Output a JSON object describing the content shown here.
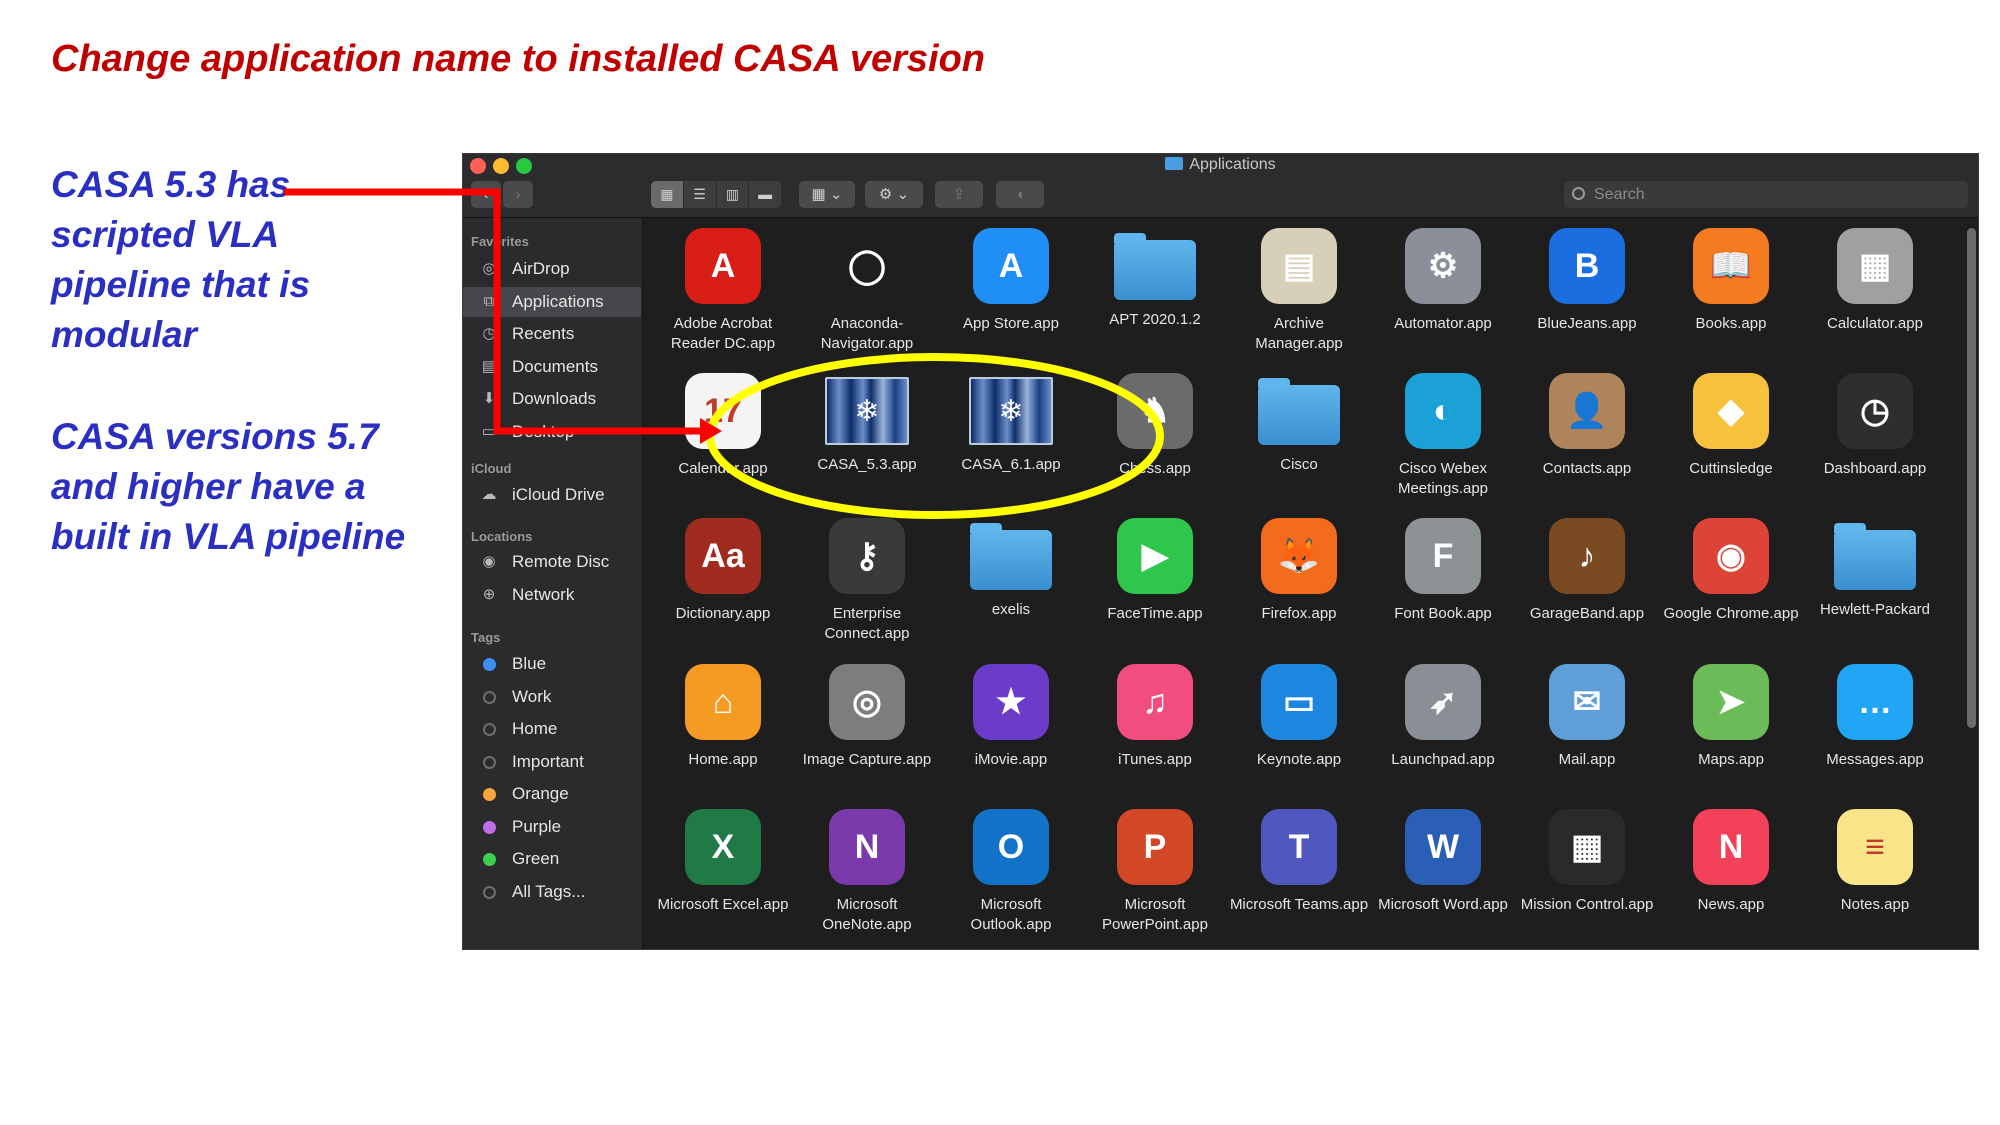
{
  "slide": {
    "title": "Change application name to installed CASA version",
    "note1_lines": [
      "CASA 5.3 has",
      "scripted VLA",
      "pipeline that is",
      "modular"
    ],
    "note2_lines": [
      "CASA versions 5.7",
      "and higher have a",
      "built in VLA pipeline"
    ]
  },
  "window": {
    "title": "Applications",
    "search_placeholder": "Search"
  },
  "sidebar": {
    "favorites_label": "Favorites",
    "favorites": [
      {
        "label": "AirDrop",
        "icon": "airdrop-icon"
      },
      {
        "label": "Applications",
        "icon": "applications-icon",
        "selected": true
      },
      {
        "label": "Recents",
        "icon": "recents-icon"
      },
      {
        "label": "Documents",
        "icon": "documents-icon"
      },
      {
        "label": "Downloads",
        "icon": "downloads-icon"
      },
      {
        "label": "Desktop",
        "icon": "desktop-icon"
      }
    ],
    "icloud_label": "iCloud",
    "icloud": [
      {
        "label": "iCloud Drive",
        "icon": "cloud-icon"
      }
    ],
    "locations_label": "Locations",
    "locations": [
      {
        "label": "Remote Disc",
        "icon": "disc-icon"
      },
      {
        "label": "Network",
        "icon": "globe-icon"
      }
    ],
    "tags_label": "Tags",
    "tags": [
      {
        "label": "Blue",
        "color": "#3b8ff5"
      },
      {
        "label": "Work",
        "color": "#2b2a2c"
      },
      {
        "label": "Home",
        "color": "#2b2a2c"
      },
      {
        "label": "Important",
        "color": "#2b2a2c"
      },
      {
        "label": "Orange",
        "color": "#f7a43a"
      },
      {
        "label": "Purple",
        "color": "#bf6ee6"
      },
      {
        "label": "Green",
        "color": "#3fcf4f"
      },
      {
        "label": "All Tags...",
        "color": "#2b2a2c"
      }
    ]
  },
  "apps": [
    {
      "label": "Adobe Acrobat Reader DC.app",
      "icon": "acrobat-icon",
      "bg": "#d91e18",
      "glyph": "A"
    },
    {
      "label": "Anaconda-Navigator.app",
      "icon": "anaconda-icon",
      "bg": "#1e1e1e",
      "glyph": "◯"
    },
    {
      "label": "App Store.app",
      "icon": "app-store-icon",
      "bg": "#1f8ff5",
      "glyph": "A"
    },
    {
      "label": "APT 2020.1.2",
      "icon": "folder-icon",
      "folder": true
    },
    {
      "label": "Archive Manager.app",
      "icon": "archive-icon",
      "bg": "#d8cfb8",
      "glyph": "▤"
    },
    {
      "label": "Automator.app",
      "icon": "automator-icon",
      "bg": "#8a8f99",
      "glyph": "⚙"
    },
    {
      "label": "BlueJeans.app",
      "icon": "bluejeans-icon",
      "bg": "#1b6ee0",
      "glyph": "B"
    },
    {
      "label": "Books.app",
      "icon": "books-icon",
      "bg": "#f47b20",
      "glyph": "📖"
    },
    {
      "label": "Calculator.app",
      "icon": "calculator-icon",
      "bg": "#a0a0a0",
      "glyph": "▦"
    },
    {
      "label": "Calendar.app",
      "icon": "calendar-icon",
      "bg": "#f4f4f4",
      "glyph": "17",
      "dark": true
    },
    {
      "label": "CASA_5.3.app",
      "icon": "casa-icon",
      "casa": true
    },
    {
      "label": "CASA_6.1.app",
      "icon": "casa-icon",
      "casa": true
    },
    {
      "label": "Chess.app",
      "icon": "chess-icon",
      "bg": "#6b6b6b",
      "glyph": "♞"
    },
    {
      "label": "Cisco",
      "icon": "folder-icon",
      "folder": true
    },
    {
      "label": "Cisco Webex Meetings.app",
      "icon": "webex-icon",
      "bg": "#1ba1d6",
      "glyph": "◐"
    },
    {
      "label": "Contacts.app",
      "icon": "contacts-icon",
      "bg": "#b0845a",
      "glyph": "👤"
    },
    {
      "label": "Cuttinsledge",
      "icon": "sketch-icon",
      "bg": "#f6c23b",
      "glyph": "◆"
    },
    {
      "label": "Dashboard.app",
      "icon": "dashboard-icon",
      "bg": "#2e2e2e",
      "glyph": "◷"
    },
    {
      "label": "Dictionary.app",
      "icon": "dictionary-icon",
      "bg": "#a02c20",
      "glyph": "Aa"
    },
    {
      "label": "Enterprise Connect.app",
      "icon": "key-icon",
      "bg": "#3a3a3a",
      "glyph": "⚷"
    },
    {
      "label": "exelis",
      "icon": "folder-icon",
      "folder": true
    },
    {
      "label": "FaceTime.app",
      "icon": "facetime-icon",
      "bg": "#2fc64c",
      "glyph": "▶"
    },
    {
      "label": "Firefox.app",
      "icon": "firefox-icon",
      "bg": "#f36b1c",
      "glyph": "🦊"
    },
    {
      "label": "Font Book.app",
      "icon": "fontbook-icon",
      "bg": "#8d9295",
      "glyph": "F"
    },
    {
      "label": "GarageBand.app",
      "icon": "garageband-icon",
      "bg": "#7a4a23",
      "glyph": "♪"
    },
    {
      "label": "Google Chrome.app",
      "icon": "chrome-icon",
      "bg": "#dd4437",
      "glyph": "◉"
    },
    {
      "label": "Hewlett-Packard",
      "icon": "hp-folder-icon",
      "folder": true
    },
    {
      "label": "Home.app",
      "icon": "home-icon",
      "bg": "#f59a23",
      "glyph": "⌂"
    },
    {
      "label": "Image Capture.app",
      "icon": "camera-icon",
      "bg": "#7d7d7d",
      "glyph": "◎"
    },
    {
      "label": "iMovie.app",
      "icon": "imovie-icon",
      "bg": "#6a3cc9",
      "glyph": "★"
    },
    {
      "label": "iTunes.app",
      "icon": "itunes-icon",
      "bg": "#f24d7f",
      "glyph": "♫"
    },
    {
      "label": "Keynote.app",
      "icon": "keynote-icon",
      "bg": "#1d87e0",
      "glyph": "▭"
    },
    {
      "label": "Launchpad.app",
      "icon": "rocket-icon",
      "bg": "#8a8f95",
      "glyph": "➶"
    },
    {
      "label": "Mail.app",
      "icon": "mail-icon",
      "bg": "#5d9fd6",
      "glyph": "✉"
    },
    {
      "label": "Maps.app",
      "icon": "maps-icon",
      "bg": "#6cbb59",
      "glyph": "➤"
    },
    {
      "label": "Messages.app",
      "icon": "messages-icon",
      "bg": "#21a6f5",
      "glyph": "…"
    },
    {
      "label": "Microsoft Excel.app",
      "icon": "excel-icon",
      "bg": "#1f7a45",
      "glyph": "X"
    },
    {
      "label": "Microsoft OneNote.app",
      "icon": "onenote-icon",
      "bg": "#7b3aab",
      "glyph": "N"
    },
    {
      "label": "Microsoft Outlook.app",
      "icon": "outlook-icon",
      "bg": "#1273c8",
      "glyph": "O"
    },
    {
      "label": "Microsoft PowerPoint.app",
      "icon": "powerpoint-icon",
      "bg": "#d24726",
      "glyph": "P"
    },
    {
      "label": "Microsoft Teams.app",
      "icon": "teams-icon",
      "bg": "#5058bf",
      "glyph": "T"
    },
    {
      "label": "Microsoft Word.app",
      "icon": "word-icon",
      "bg": "#2b5fb5",
      "glyph": "W"
    },
    {
      "label": "Mission Control.app",
      "icon": "mission-control-icon",
      "bg": "#2a2a2a",
      "glyph": "▦"
    },
    {
      "label": "News.app",
      "icon": "news-icon",
      "bg": "#f3415a",
      "glyph": "N"
    },
    {
      "label": "Notes.app",
      "icon": "notes-icon",
      "bg": "#f8e58a",
      "glyph": "≡",
      "dark": true
    }
  ],
  "colors": {
    "annotation_red": "#ff0000",
    "highlight_yellow": "#ffff00",
    "title_red": "#c00000",
    "note_blue": "#2a2fc2"
  }
}
